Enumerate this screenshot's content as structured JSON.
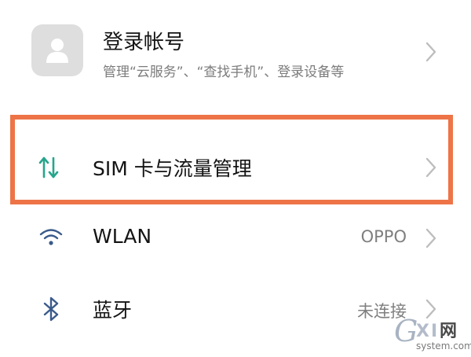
{
  "account": {
    "title": "登录帐号",
    "subtitle": "管理“云服务”、“查找手机”、登录设备等",
    "avatar_icon": "person-icon"
  },
  "sim": {
    "label": "SIM 卡与流量管理",
    "icon": "data-transfer-arrows-icon",
    "highlight_color": "#ee7447"
  },
  "wlan": {
    "label": "WLAN",
    "value": "OPPO",
    "icon": "wifi-icon"
  },
  "bluetooth": {
    "label": "蓝牙",
    "value": "未连接",
    "icon": "bluetooth-icon"
  },
  "watermark": {
    "brand": "GXI网",
    "site": "system.com"
  },
  "colors": {
    "icon_green": "#27a58c",
    "icon_blue": "#3a5a8a",
    "chevron": "#bdbdbd",
    "secondary_text": "#7c7c7c"
  }
}
